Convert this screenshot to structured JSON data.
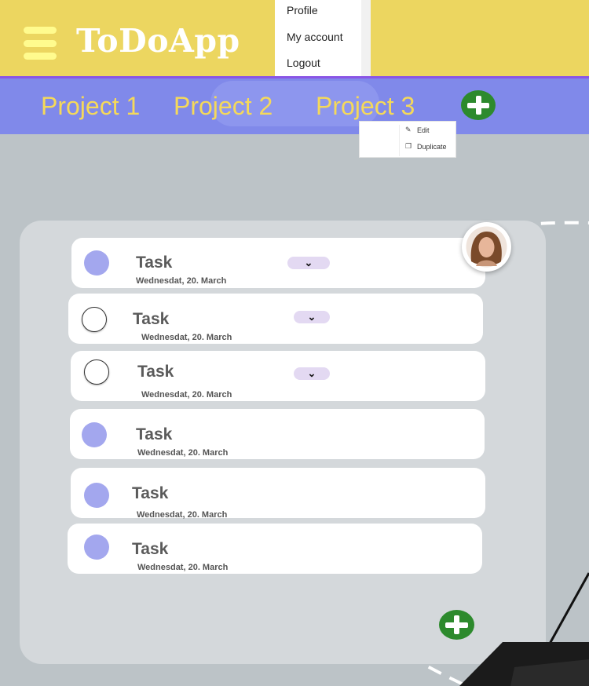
{
  "header": {
    "app_title": "ToDoApp",
    "menu_icon": "hamburger-icon"
  },
  "profile_menu": {
    "items": [
      "Profile",
      "My account",
      "Logout"
    ]
  },
  "projects": {
    "tabs": [
      "Project 1",
      "Project 2",
      "Project 3"
    ],
    "add_icon": "plus-circle-icon"
  },
  "context_menu": {
    "items": [
      {
        "label": "Edit",
        "icon": "pencil-icon"
      },
      {
        "label": "Duplicate",
        "icon": "copy-icon"
      }
    ]
  },
  "tasks": [
    {
      "name": "Task",
      "date": "Wednesdat, 20. March",
      "done": true,
      "expandable": true
    },
    {
      "name": "Task",
      "date": "Wednesdat, 20. March",
      "done": false,
      "expandable": true
    },
    {
      "name": "Task",
      "date": "Wednesdat, 20. March",
      "done": false,
      "expandable": true
    },
    {
      "name": "Task",
      "date": "Wednesdat, 20. March",
      "done": true,
      "expandable": false
    },
    {
      "name": "Task",
      "date": "Wednesdat, 20. March",
      "done": true,
      "expandable": false
    },
    {
      "name": "Task",
      "date": "Wednesdat, 20. March",
      "done": true,
      "expandable": false
    }
  ],
  "colors": {
    "header_bg": "#ecd660",
    "project_bar_bg": "#8089ea",
    "project_text": "#f5d95a",
    "accent_green": "#2d8a2d",
    "check_filled": "#a3a7ee",
    "page_bg": "#bcc3c7"
  },
  "expand_icon": "chevron-down-icon",
  "avatar_icon": "user-avatar"
}
